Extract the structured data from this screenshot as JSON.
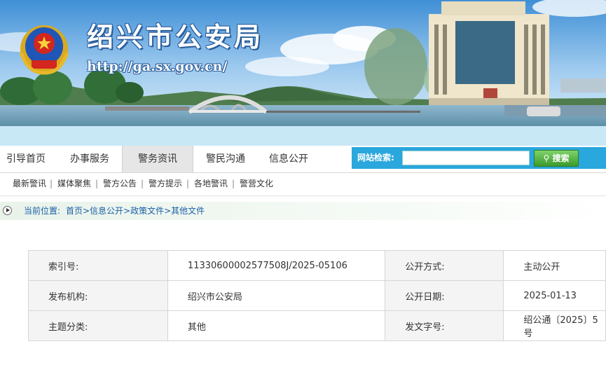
{
  "header": {
    "title": "绍兴市公安局",
    "url": "http://ga.sx.gov.cn/"
  },
  "nav": {
    "tabs": [
      {
        "label": "引导首页"
      },
      {
        "label": "办事服务"
      },
      {
        "label": "警务资讯",
        "active": true
      },
      {
        "label": "警民沟通"
      },
      {
        "label": "信息公开"
      }
    ]
  },
  "search": {
    "label": "网站检索:",
    "placeholder": "",
    "button": "搜索"
  },
  "subnav": {
    "items": [
      "最新警讯",
      "媒体聚焦",
      "警方公告",
      "警方提示",
      "各地警讯",
      "警营文化"
    ],
    "separator": "|"
  },
  "breadcrumb": {
    "label": "当前位置:",
    "path": "首页>信息公开>政策文件>其他文件"
  },
  "meta": {
    "index_label": "索引号:",
    "index_value": "11330600002577508J/2025-05106",
    "method_label": "公开方式:",
    "method_value": "主动公开",
    "org_label": "发布机构:",
    "org_value": "绍兴市公安局",
    "date_label": "公开日期:",
    "date_value": "2025-01-13",
    "topic_label": "主题分类:",
    "topic_value": "其他",
    "docno_label": "发文字号:",
    "docno_value": "绍公通〔2025〕5号"
  },
  "colors": {
    "search_bar": "#2aa7dc",
    "search_button": "#4caf3a",
    "link": "#1a5fa8",
    "strip": "#c9e8f6"
  }
}
